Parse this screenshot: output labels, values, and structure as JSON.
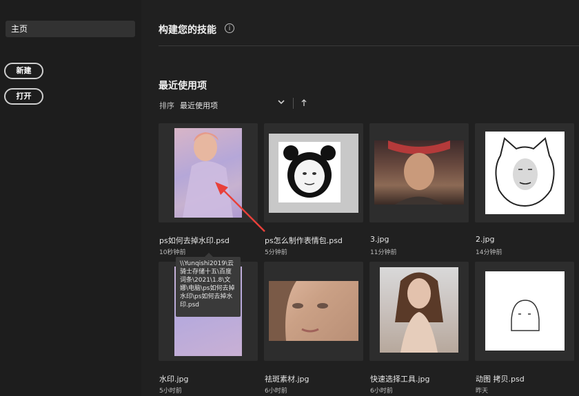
{
  "sidebar": {
    "home_label": "主页",
    "new_label": "新建",
    "open_label": "打开"
  },
  "header": {
    "title": "构建您的技能",
    "info_icon": "info-icon"
  },
  "recent": {
    "title": "最近使用项",
    "sort_label": "排序",
    "sort_value": "最近使用项",
    "sort_direction_icon": "arrow-up-icon"
  },
  "files": [
    {
      "name": "ps如何去掉水印.psd",
      "time": "10秒钟前"
    },
    {
      "name": "ps怎么制作表情包.psd",
      "time": "5分钟前"
    },
    {
      "name": "3.jpg",
      "time": "11分钟前"
    },
    {
      "name": "2.jpg",
      "time": "14分钟前"
    },
    {
      "name": "水印.jpg",
      "time": "5小时前"
    },
    {
      "name": "祛斑素材.jpg",
      "time": "6小时前"
    },
    {
      "name": "快速选择工具.jpg",
      "time": "6小时前"
    },
    {
      "name": "动图 拷贝.psd",
      "time": "昨天"
    }
  ],
  "tooltip": {
    "text": "\\\\Yunqishi2019\\云骑士存储十五\\百度词条\\2021\\1.8\\文娜\\电脑\\ps如何去掉水印\\ps如何去掉水印.psd"
  },
  "colors": {
    "background": "#202020",
    "card": "#2d2d2d",
    "annotation_arrow": "#e8403a"
  }
}
